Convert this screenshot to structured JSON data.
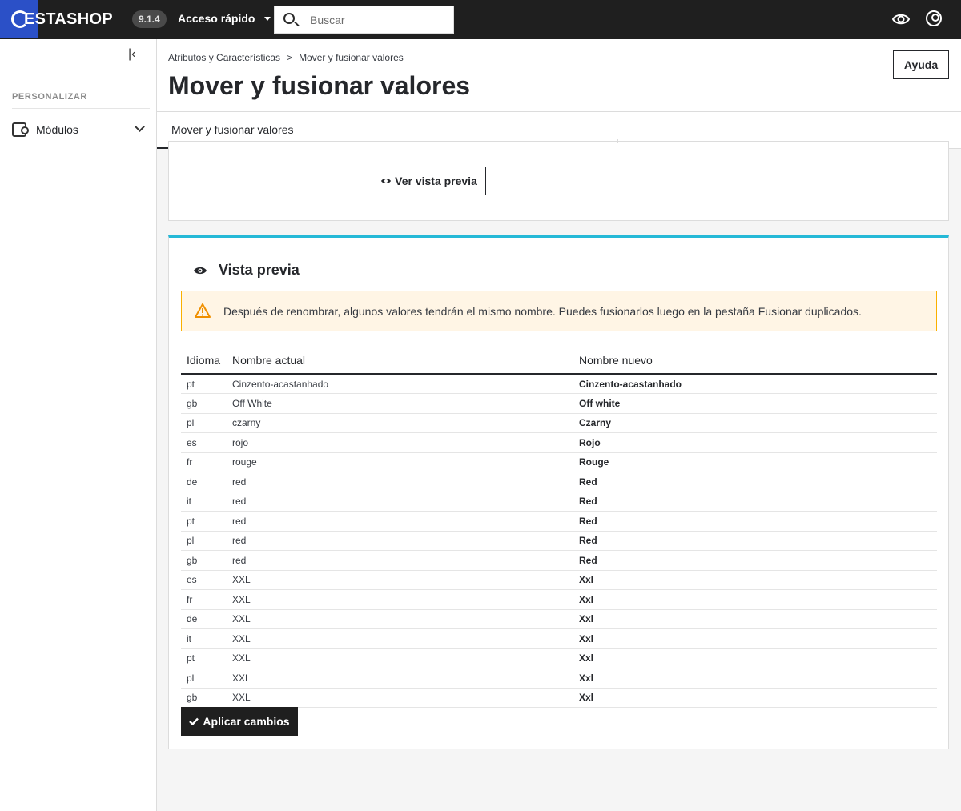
{
  "topbar": {
    "brand": "ESTASHOP",
    "version": "9.1.4",
    "quick_access_label": "Acceso rápido",
    "search_placeholder": "Buscar"
  },
  "sidebar": {
    "section_title": "PERSONALIZAR",
    "modules_label": "Módulos"
  },
  "header": {
    "breadcrumb": [
      "Atributos y Características",
      "Mover y fusionar valores"
    ],
    "breadcrumb_separator": ">",
    "title": "Mover y fusionar valores",
    "help_label": "Ayuda"
  },
  "tabs": [
    {
      "label": "Mover y fusionar valores"
    }
  ],
  "form": {
    "preview_button_label": "Ver vista previa"
  },
  "preview": {
    "title": "Vista previa",
    "warning": "Después de renombrar, algunos valores tendrán el mismo nombre. Puedes fusionarlos luego en la pestaña Fusionar duplicados.",
    "columns": [
      "Idioma",
      "Nombre actual",
      "Nombre nuevo"
    ],
    "rows": [
      [
        "pt",
        "Cinzento-acastanhado",
        "Cinzento-acastanhado"
      ],
      [
        "gb",
        "Off White",
        "Off white"
      ],
      [
        "pl",
        "czarny",
        "Czarny"
      ],
      [
        "es",
        "rojo",
        "Rojo"
      ],
      [
        "fr",
        "rouge",
        "Rouge"
      ],
      [
        "de",
        "red",
        "Red"
      ],
      [
        "it",
        "red",
        "Red"
      ],
      [
        "pt",
        "red",
        "Red"
      ],
      [
        "pl",
        "red",
        "Red"
      ],
      [
        "gb",
        "red",
        "Red"
      ],
      [
        "es",
        "XXL",
        "Xxl"
      ],
      [
        "fr",
        "XXL",
        "Xxl"
      ],
      [
        "de",
        "XXL",
        "Xxl"
      ],
      [
        "it",
        "XXL",
        "Xxl"
      ],
      [
        "pt",
        "XXL",
        "Xxl"
      ],
      [
        "pl",
        "XXL",
        "Xxl"
      ],
      [
        "gb",
        "XXL",
        "Xxl"
      ]
    ],
    "apply_button_label": "Aplicar cambios"
  },
  "colors": {
    "topbar_bg": "#1f1f1f",
    "logo_bg": "#2b50c7",
    "accent": "#25b9d7",
    "warning_bg": "#fff5e5",
    "warning_border": "#fab000"
  }
}
